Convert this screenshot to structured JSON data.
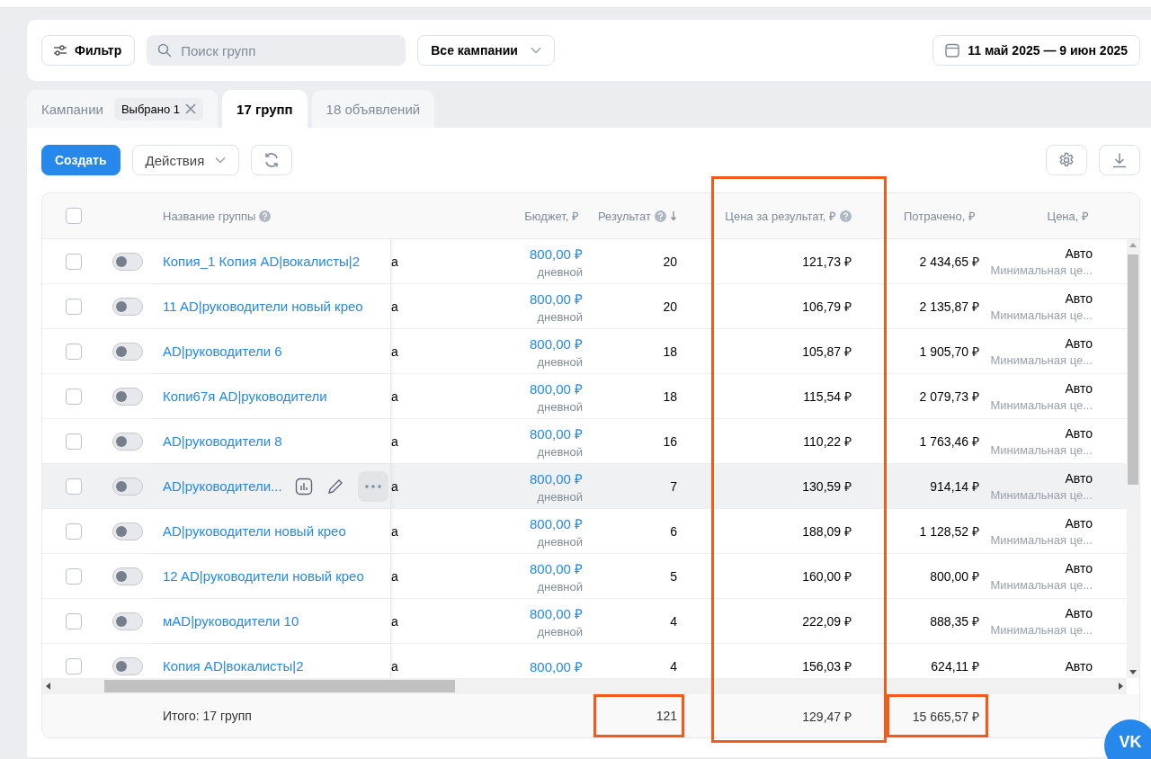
{
  "toolbar": {
    "filter_label": "Фильтр",
    "search_placeholder": "Поиск групп",
    "campaign_select": "Все кампании",
    "date_range": "11 май 2025 — 9 июн 2025"
  },
  "tabs": [
    {
      "label": "Кампании",
      "chip": "Выбрано 1",
      "selected": false
    },
    {
      "label": "17 групп",
      "selected": true
    },
    {
      "label": "18 объявлений",
      "selected": false
    }
  ],
  "actions": {
    "create": "Создать",
    "menu": "Действия"
  },
  "table": {
    "columns": [
      {
        "label": "Название группы",
        "help": true,
        "sorted": false,
        "highlighted": false
      },
      {
        "label": "Бюджет, ₽",
        "help": false,
        "sorted": false,
        "highlighted": false
      },
      {
        "label": "Результат",
        "help": true,
        "sorted": true,
        "highlighted": false
      },
      {
        "label": "Цена за результат, ₽",
        "help": true,
        "sorted": false,
        "highlighted": true
      },
      {
        "label": "Потрачено, ₽",
        "help": false,
        "sorted": false,
        "highlighted": false
      },
      {
        "label": "Цена, ₽",
        "help": false,
        "sorted": false,
        "highlighted": false
      }
    ],
    "header_checked": false,
    "rows": [
      {
        "checked": false,
        "on": false,
        "hovered": false,
        "name": "Копия_1 Копия AD|вокалисты|2",
        "column_4": "а",
        "budget": "800,00 ₽",
        "budget_period": "дневной",
        "result": "20",
        "price_per_result": "121,73 ₽",
        "spent": "2 434,65 ₽",
        "price": "Авто",
        "price_note": "Минимальная це..."
      },
      {
        "checked": false,
        "on": false,
        "hovered": false,
        "name": "11 AD|руководители новый крео",
        "column_4": "а",
        "budget": "800,00 ₽",
        "budget_period": "дневной",
        "result": "20",
        "price_per_result": "106,79 ₽",
        "spent": "2 135,87 ₽",
        "price": "Авто",
        "price_note": "Минимальная це..."
      },
      {
        "checked": false,
        "on": false,
        "hovered": false,
        "name": "AD|руководители 6",
        "column_4": "а",
        "budget": "800,00 ₽",
        "budget_period": "дневной",
        "result": "18",
        "price_per_result": "105,87 ₽",
        "spent": "1 905,70 ₽",
        "price": "Авто",
        "price_note": "Минимальная це..."
      },
      {
        "checked": false,
        "on": false,
        "hovered": false,
        "name": "Копи67я AD|руководители",
        "column_4": "а",
        "budget": "800,00 ₽",
        "budget_period": "дневной",
        "result": "18",
        "price_per_result": "115,54 ₽",
        "spent": "2 079,73 ₽",
        "price": "Авто",
        "price_note": "Минимальная це..."
      },
      {
        "checked": false,
        "on": false,
        "hovered": false,
        "name": "AD|руководители 8",
        "column_4": "а",
        "budget": "800,00 ₽",
        "budget_period": "дневной",
        "result": "16",
        "price_per_result": "110,22 ₽",
        "spent": "1 763,46 ₽",
        "price": "Авто",
        "price_note": "Минимальная це..."
      },
      {
        "checked": false,
        "on": false,
        "hovered": true,
        "name": "AD|руководители...",
        "column_4": "а",
        "budget": "800,00 ₽",
        "budget_period": "дневной",
        "result": "7",
        "price_per_result": "130,59 ₽",
        "spent": "914,14 ₽",
        "price": "Авто",
        "price_note": "Минимальная це..."
      },
      {
        "checked": false,
        "on": false,
        "hovered": false,
        "name": "AD|руководители новый крео",
        "column_4": "а",
        "budget": "800,00 ₽",
        "budget_period": "дневной",
        "result": "6",
        "price_per_result": "188,09 ₽",
        "spent": "1 128,52 ₽",
        "price": "Авто",
        "price_note": "Минимальная це..."
      },
      {
        "checked": false,
        "on": false,
        "hovered": false,
        "name": "12 AD|руководители новый крео",
        "column_4": "а",
        "budget": "800,00 ₽",
        "budget_period": "дневной",
        "result": "5",
        "price_per_result": "160,00 ₽",
        "spent": "800,00 ₽",
        "price": "Авто",
        "price_note": "Минимальная це..."
      },
      {
        "checked": false,
        "on": false,
        "hovered": false,
        "name": "мAD|руководители 10",
        "column_4": "а",
        "budget": "800,00 ₽",
        "budget_period": "дневной",
        "result": "4",
        "price_per_result": "222,09 ₽",
        "spent": "888,35 ₽",
        "price": "Авто",
        "price_note": "Минимальная це..."
      },
      {
        "checked": false,
        "on": false,
        "hovered": false,
        "name": "Копия AD|вокалисты|2",
        "column_4": "а",
        "budget": "800,00 ₽",
        "result": "4",
        "price_per_result": "156,03 ₽",
        "spent": "624,11 ₽",
        "price": "Авто"
      }
    ],
    "totals": {
      "label": "Итого: 17 групп",
      "cells": [
        {
          "text": "121",
          "highlighted": true
        },
        {
          "text": "129,47 ₽",
          "highlighted": false
        },
        {
          "text": "15 665,57 ₽",
          "highlighted": true
        }
      ]
    }
  },
  "chat_button": {
    "label": "VK"
  }
}
